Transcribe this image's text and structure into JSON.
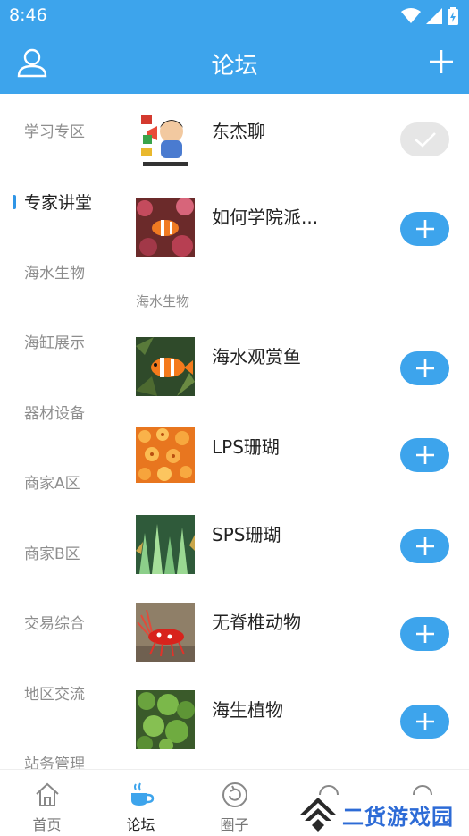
{
  "status_bar": {
    "time": "8:46"
  },
  "app_bar": {
    "title": "论坛",
    "colors": {
      "primary": "#3da4ec"
    }
  },
  "sidebar": {
    "items": [
      {
        "label": "学习专区",
        "active": false
      },
      {
        "label": "专家讲堂",
        "active": true
      },
      {
        "label": "海水生物",
        "active": false
      },
      {
        "label": "海缸展示",
        "active": false
      },
      {
        "label": "器材设备",
        "active": false
      },
      {
        "label": "商家A区",
        "active": false
      },
      {
        "label": "商家B区",
        "active": false
      },
      {
        "label": "交易综合",
        "active": false
      },
      {
        "label": "地区交流",
        "active": false
      },
      {
        "label": "站务管理",
        "active": false
      }
    ]
  },
  "content": {
    "expert_rows": [
      {
        "title": "东杰聊",
        "joined": true,
        "icon": "check-icon"
      },
      {
        "title": "如何学院派...",
        "joined": false,
        "icon": "plus-icon"
      }
    ],
    "section_label": "海水生物",
    "section_rows": [
      {
        "title": "海水观赏鱼",
        "joined": false
      },
      {
        "title": "LPS珊瑚",
        "joined": false
      },
      {
        "title": "SPS珊瑚",
        "joined": false
      },
      {
        "title": "无脊椎动物",
        "joined": false
      },
      {
        "title": "海生植物",
        "joined": false
      }
    ]
  },
  "bottom_nav": {
    "items": [
      {
        "label": "首页",
        "icon": "home-icon",
        "active": false
      },
      {
        "label": "论坛",
        "icon": "cup-icon",
        "active": true
      },
      {
        "label": "圈子",
        "icon": "refresh-circle-icon",
        "active": false
      }
    ]
  },
  "watermark": {
    "text": "二货游戏园"
  }
}
